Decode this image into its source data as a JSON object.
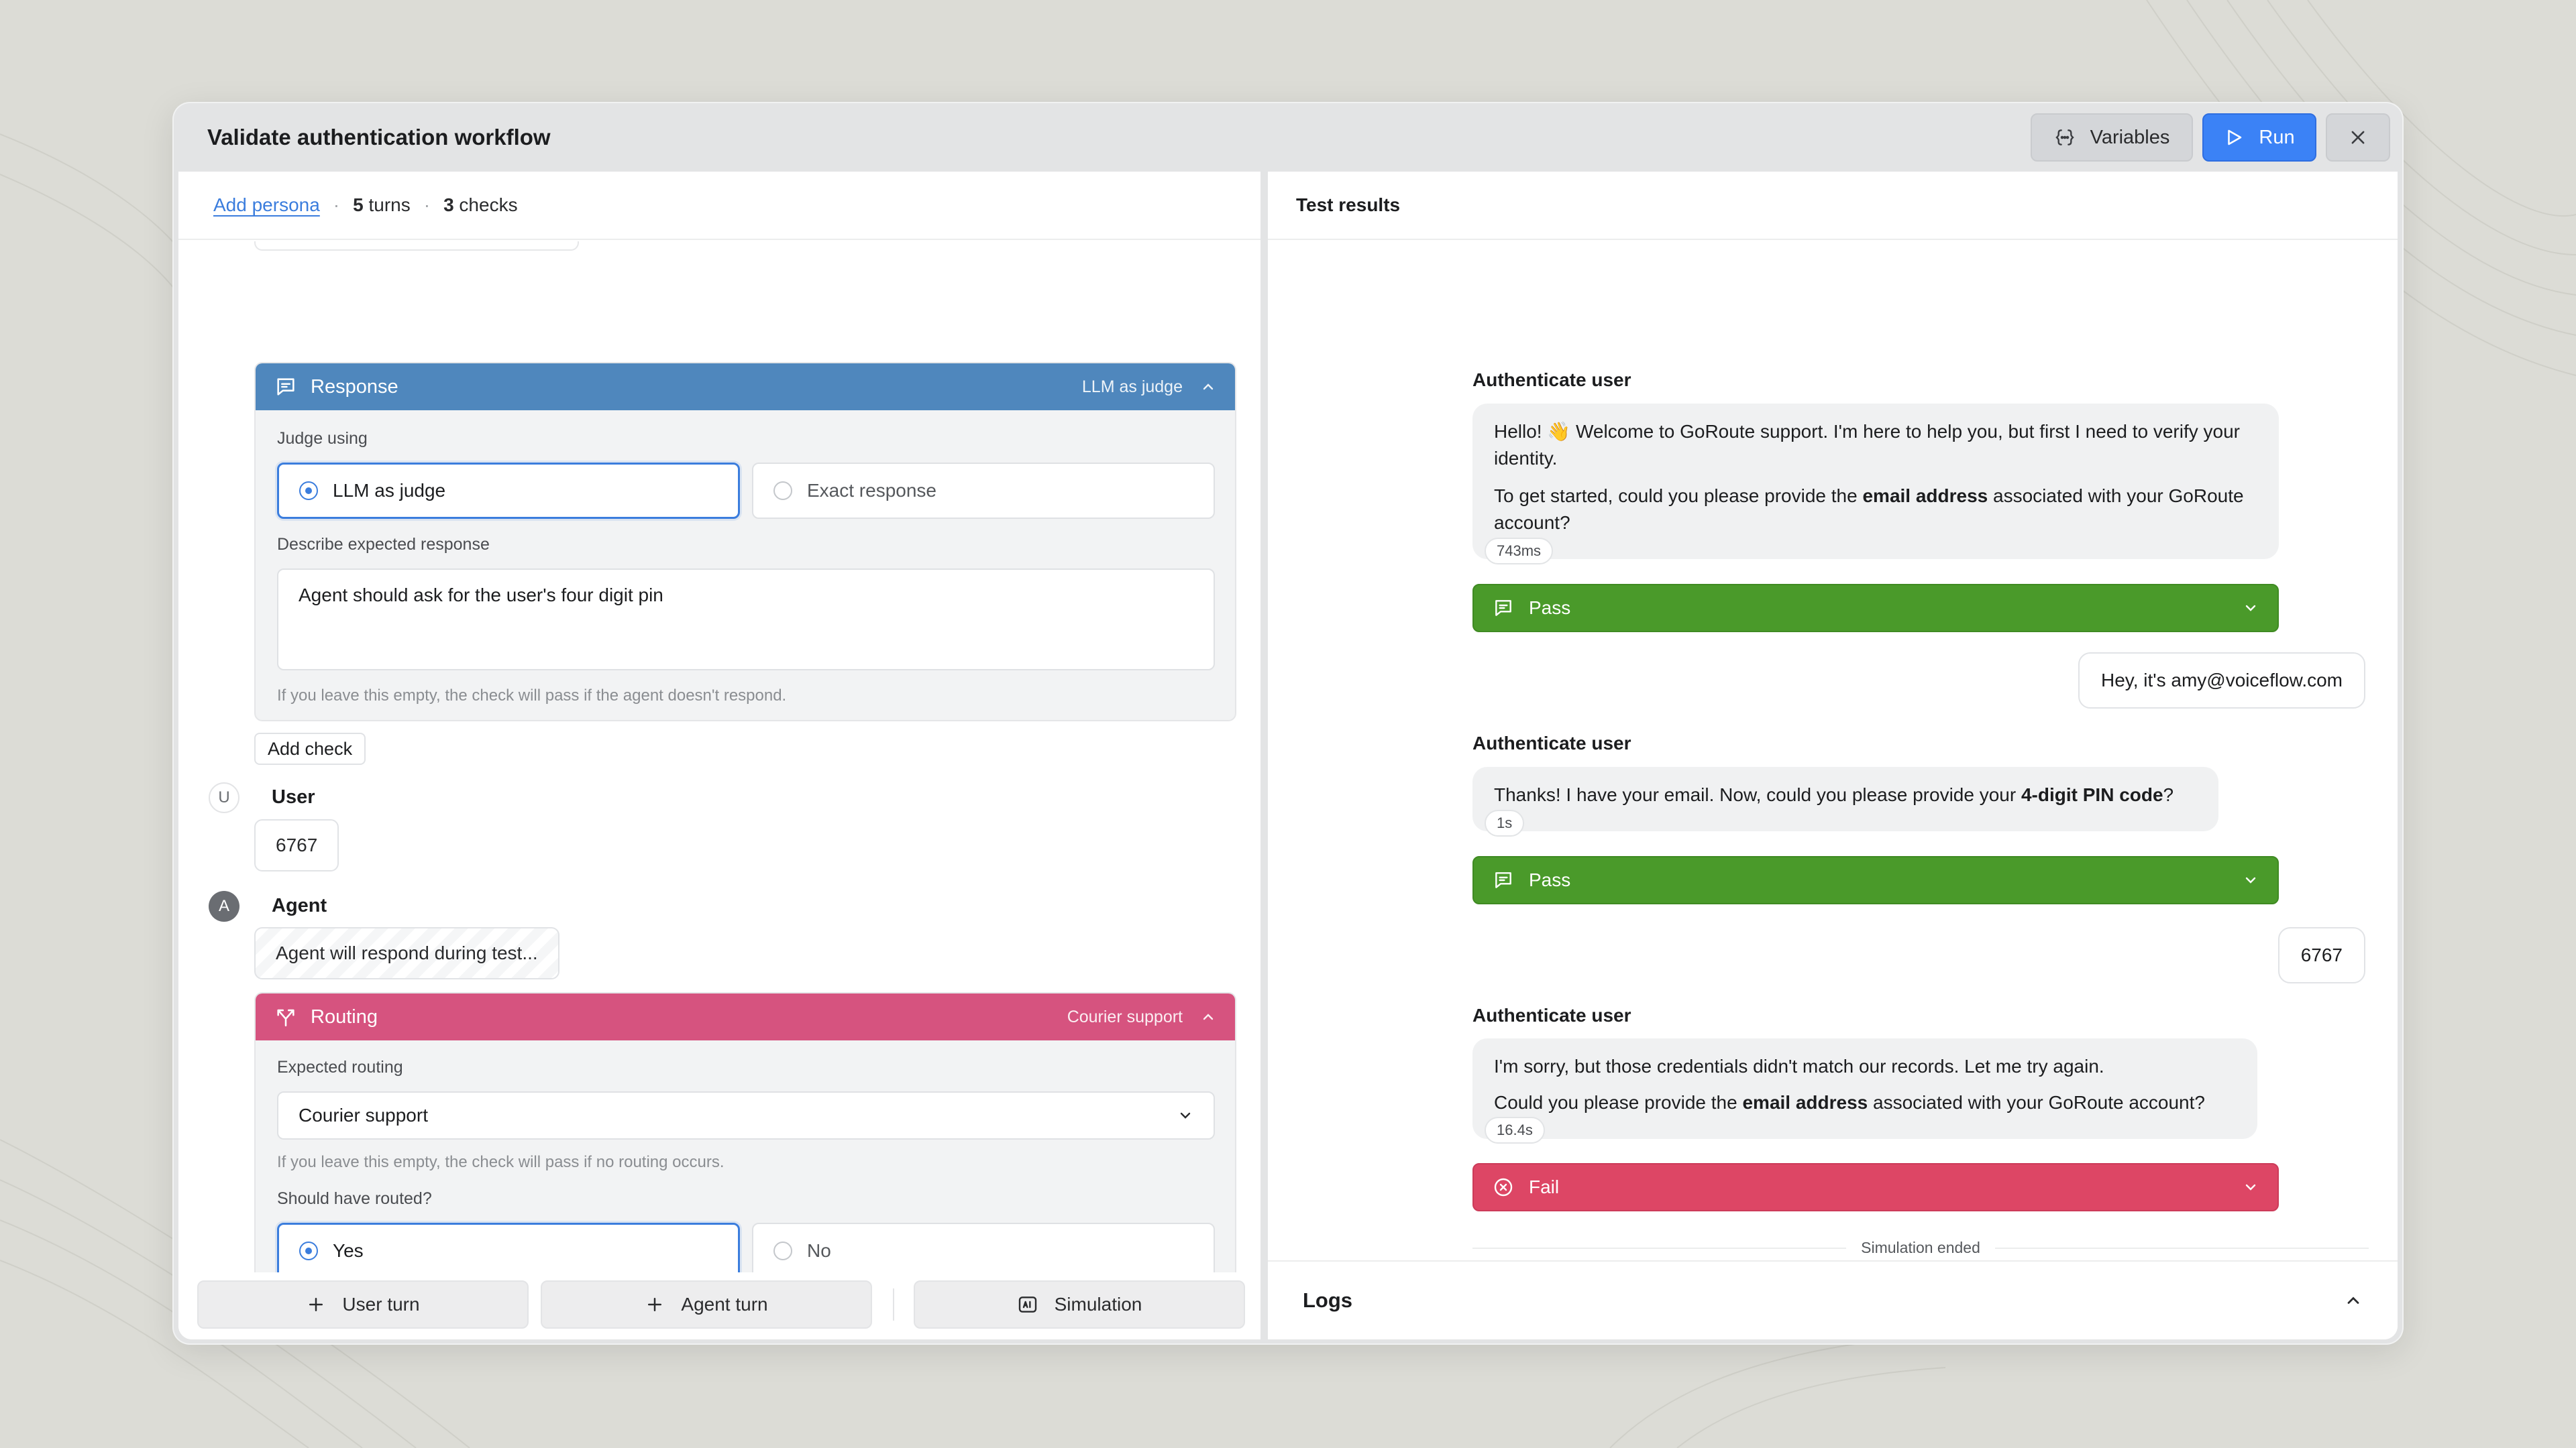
{
  "window": {
    "title": "Validate authentication workflow"
  },
  "toolbar": {
    "variables_label": "Variables",
    "run_label": "Run"
  },
  "left_header": {
    "add_persona": "Add persona",
    "sep1": "·",
    "turns_count": "5",
    "turns_label": "turns",
    "sep2": "·",
    "checks_count": "3",
    "checks_label": "checks"
  },
  "response_check": {
    "name": "Response",
    "tag": "LLM as judge",
    "judge_label": "Judge using",
    "options": [
      "LLM as judge",
      "Exact response"
    ],
    "selected": "LLM as judge",
    "describe_label": "Describe expected response",
    "expected_text": "Agent should ask for the user's four digit pin",
    "hint": "If you leave this empty, the check will pass if the agent doesn't respond.",
    "accent": "#4f87bd"
  },
  "add_check_label": "Add check",
  "user_turn": {
    "avatar": "U",
    "role": "User",
    "message": "6767"
  },
  "agent_turn": {
    "avatar": "A",
    "role": "Agent",
    "message": "Agent will respond during test..."
  },
  "routing_check": {
    "name": "Routing",
    "tag": "Courier support",
    "expected_label": "Expected routing",
    "expected_value": "Courier support",
    "hint": "If you leave this empty, the check will pass if no routing occurs.",
    "should_label": "Should have routed?",
    "options": [
      "Yes",
      "No"
    ],
    "selected": "Yes",
    "accent": "#d6537f"
  },
  "bottom_bar": {
    "user_turn": "User turn",
    "agent_turn": "Agent turn",
    "simulation": "Simulation"
  },
  "results": {
    "title": "Test results",
    "turns": [
      {
        "label": "Authenticate user",
        "para1": "Hello! 👋 Welcome to GoRoute support. I'm here to help you, but first I need to verify your identity.",
        "para2_pre": "To get started, could you please provide the ",
        "para2_bold": "email address",
        "para2_post": " associated with your GoRoute account?",
        "time": "743ms",
        "result": "Pass"
      },
      {
        "label": "Authenticate user",
        "text_pre": "Thanks! I have your email. Now, could you please provide your ",
        "text_bold": "4-digit PIN code",
        "text_post": "?",
        "time": "1s",
        "result": "Pass"
      },
      {
        "label": "Authenticate user",
        "para1": "I'm sorry, but those credentials didn't match our records. Let me try again.",
        "para2_pre": "Could you please provide the ",
        "para2_bold": "email address",
        "para2_post": " associated with your GoRoute account?",
        "time": "16.4s",
        "result": "Fail"
      }
    ],
    "user_messages": [
      "Hey, it's amy@voiceflow.com",
      "6767"
    ],
    "simulation_ended": "Simulation ended",
    "logs": "Logs",
    "colors": {
      "pass": "#4a9a2a",
      "fail": "#dd4665",
      "primary": "#3b82f6"
    }
  }
}
